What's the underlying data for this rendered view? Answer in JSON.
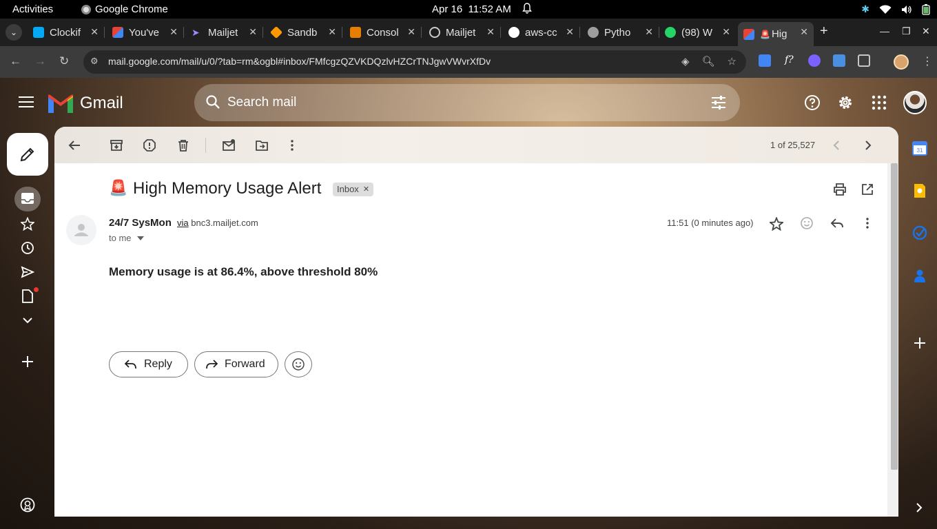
{
  "os_bar": {
    "activities": "Activities",
    "app_name": "Google Chrome",
    "date": "Apr 16",
    "time": "11:52 AM"
  },
  "browser": {
    "tabs": [
      {
        "title": "Clockif",
        "color": "#03a9f4"
      },
      {
        "title": "You've",
        "color": "#ea4335"
      },
      {
        "title": "Mailjet",
        "color": "#9c8cff"
      },
      {
        "title": "Sandb",
        "color": "#ff9900"
      },
      {
        "title": "Consol",
        "color": "#ff9900"
      },
      {
        "title": "Mailjet",
        "color": "#cccccc"
      },
      {
        "title": "aws-cc",
        "color": "#ffffff"
      },
      {
        "title": "Pytho",
        "color": "#aaaaaa"
      },
      {
        "title": "(98) W",
        "color": "#25d366"
      },
      {
        "title": "Hig",
        "color": "#ea4335"
      }
    ],
    "url": "mail.google.com/mail/u/0/?tab=rm&ogbl#inbox/FMfcgzQZVKDQzlvHZCrTNJgwVWvrXfDv"
  },
  "gmail": {
    "logo_text": "Gmail",
    "search_placeholder": "Search mail",
    "pager": "1 of 25,527",
    "email": {
      "subject_emoji": "🚨",
      "subject": "High Memory Usage Alert",
      "label": "Inbox",
      "sender_name": "24/7 SysMon",
      "via_word": "via",
      "via_domain": "bnc3.mailjet.com",
      "to": "to me",
      "received": "11:51 (0 minutes ago)",
      "body": "Memory usage is at 86.4%, above threshold 80%"
    },
    "actions": {
      "reply": "Reply",
      "forward": "Forward"
    }
  },
  "colors": {
    "accent_blue": "#0b57d0",
    "gmail_red": "#ea4335"
  }
}
